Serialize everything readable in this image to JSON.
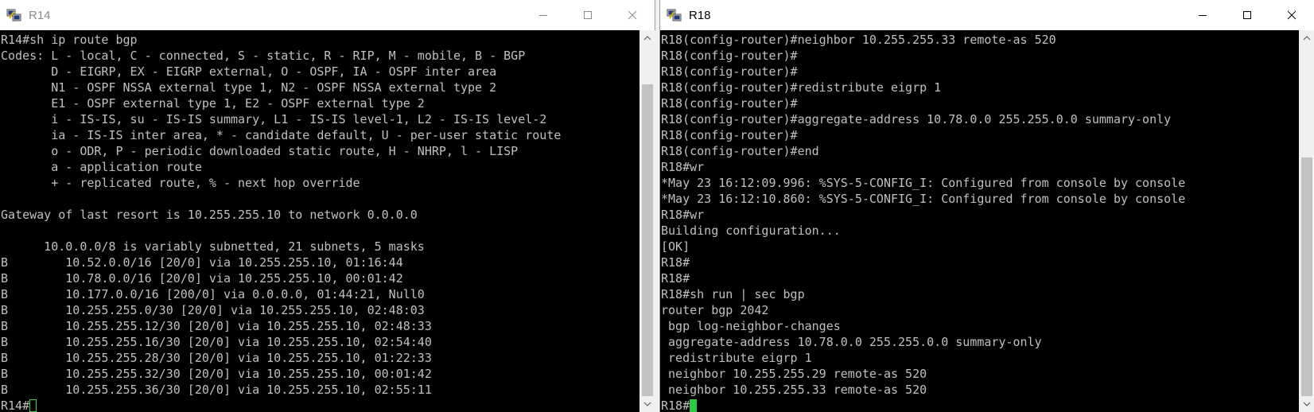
{
  "left_window": {
    "title": "R14",
    "title_color": "#8a8a8a",
    "icon": "putty-terminal-icon",
    "lines": [
      "R14#sh ip route bgp",
      "Codes: L - local, C - connected, S - static, R - RIP, M - mobile, B - BGP",
      "       D - EIGRP, EX - EIGRP external, O - OSPF, IA - OSPF inter area",
      "       N1 - OSPF NSSA external type 1, N2 - OSPF NSSA external type 2",
      "       E1 - OSPF external type 1, E2 - OSPF external type 2",
      "       i - IS-IS, su - IS-IS summary, L1 - IS-IS level-1, L2 - IS-IS level-2",
      "       ia - IS-IS inter area, * - candidate default, U - per-user static route",
      "       o - ODR, P - periodic downloaded static route, H - NHRP, l - LISP",
      "       a - application route",
      "       + - replicated route, % - next hop override",
      "",
      "Gateway of last resort is 10.255.255.10 to network 0.0.0.0",
      "",
      "      10.0.0.0/8 is variably subnetted, 21 subnets, 5 masks",
      "B        10.52.0.0/16 [20/0] via 10.255.255.10, 01:16:44",
      "B        10.78.0.0/16 [20/0] via 10.255.255.10, 00:01:42",
      "B        10.177.0.0/16 [200/0] via 0.0.0.0, 01:44:21, Null0",
      "B        10.255.255.0/30 [20/0] via 10.255.255.10, 02:48:03",
      "B        10.255.255.12/30 [20/0] via 10.255.255.10, 02:48:33",
      "B        10.255.255.16/30 [20/0] via 10.255.255.10, 02:54:40",
      "B        10.255.255.28/30 [20/0] via 10.255.255.10, 01:22:33",
      "B        10.255.255.32/30 [20/0] via 10.255.255.10, 00:01:42",
      "B        10.255.255.36/30 [20/0] via 10.255.255.10, 02:55:11"
    ],
    "prompt": "R14#"
  },
  "right_window": {
    "title": "R18",
    "title_color": "#000000",
    "icon": "putty-terminal-icon",
    "lines": [
      "R18(config-router)#neighbor 10.255.255.33 remote-as 520",
      "R18(config-router)#",
      "R18(config-router)#",
      "R18(config-router)#redistribute eigrp 1",
      "R18(config-router)#",
      "R18(config-router)#aggregate-address 10.78.0.0 255.255.0.0 summary-only",
      "R18(config-router)#",
      "R18(config-router)#end",
      "R18#wr",
      "*May 23 16:12:09.996: %SYS-5-CONFIG_I: Configured from console by console",
      "*May 23 16:12:10.860: %SYS-5-CONFIG_I: Configured from console by console",
      "R18#wr",
      "Building configuration...",
      "[OK]",
      "R18#",
      "R18#",
      "R18#sh run | sec bgp",
      "router bgp 2042",
      " bgp log-neighbor-changes",
      " aggregate-address 10.78.0.0 255.255.0.0 summary-only",
      " redistribute eigrp 1",
      " neighbor 10.255.255.29 remote-as 520",
      " neighbor 10.255.255.33 remote-as 520"
    ],
    "prompt": "R18#"
  },
  "colors": {
    "terminal_bg": "#000000",
    "terminal_fg": "#c0c0c0",
    "cursor": "#2ecc40",
    "scrollbar_track": "#f0f0f0",
    "scrollbar_thumb": "#c2c2c2"
  },
  "controls_icons": [
    "minimize-icon",
    "maximize-icon",
    "close-icon"
  ]
}
